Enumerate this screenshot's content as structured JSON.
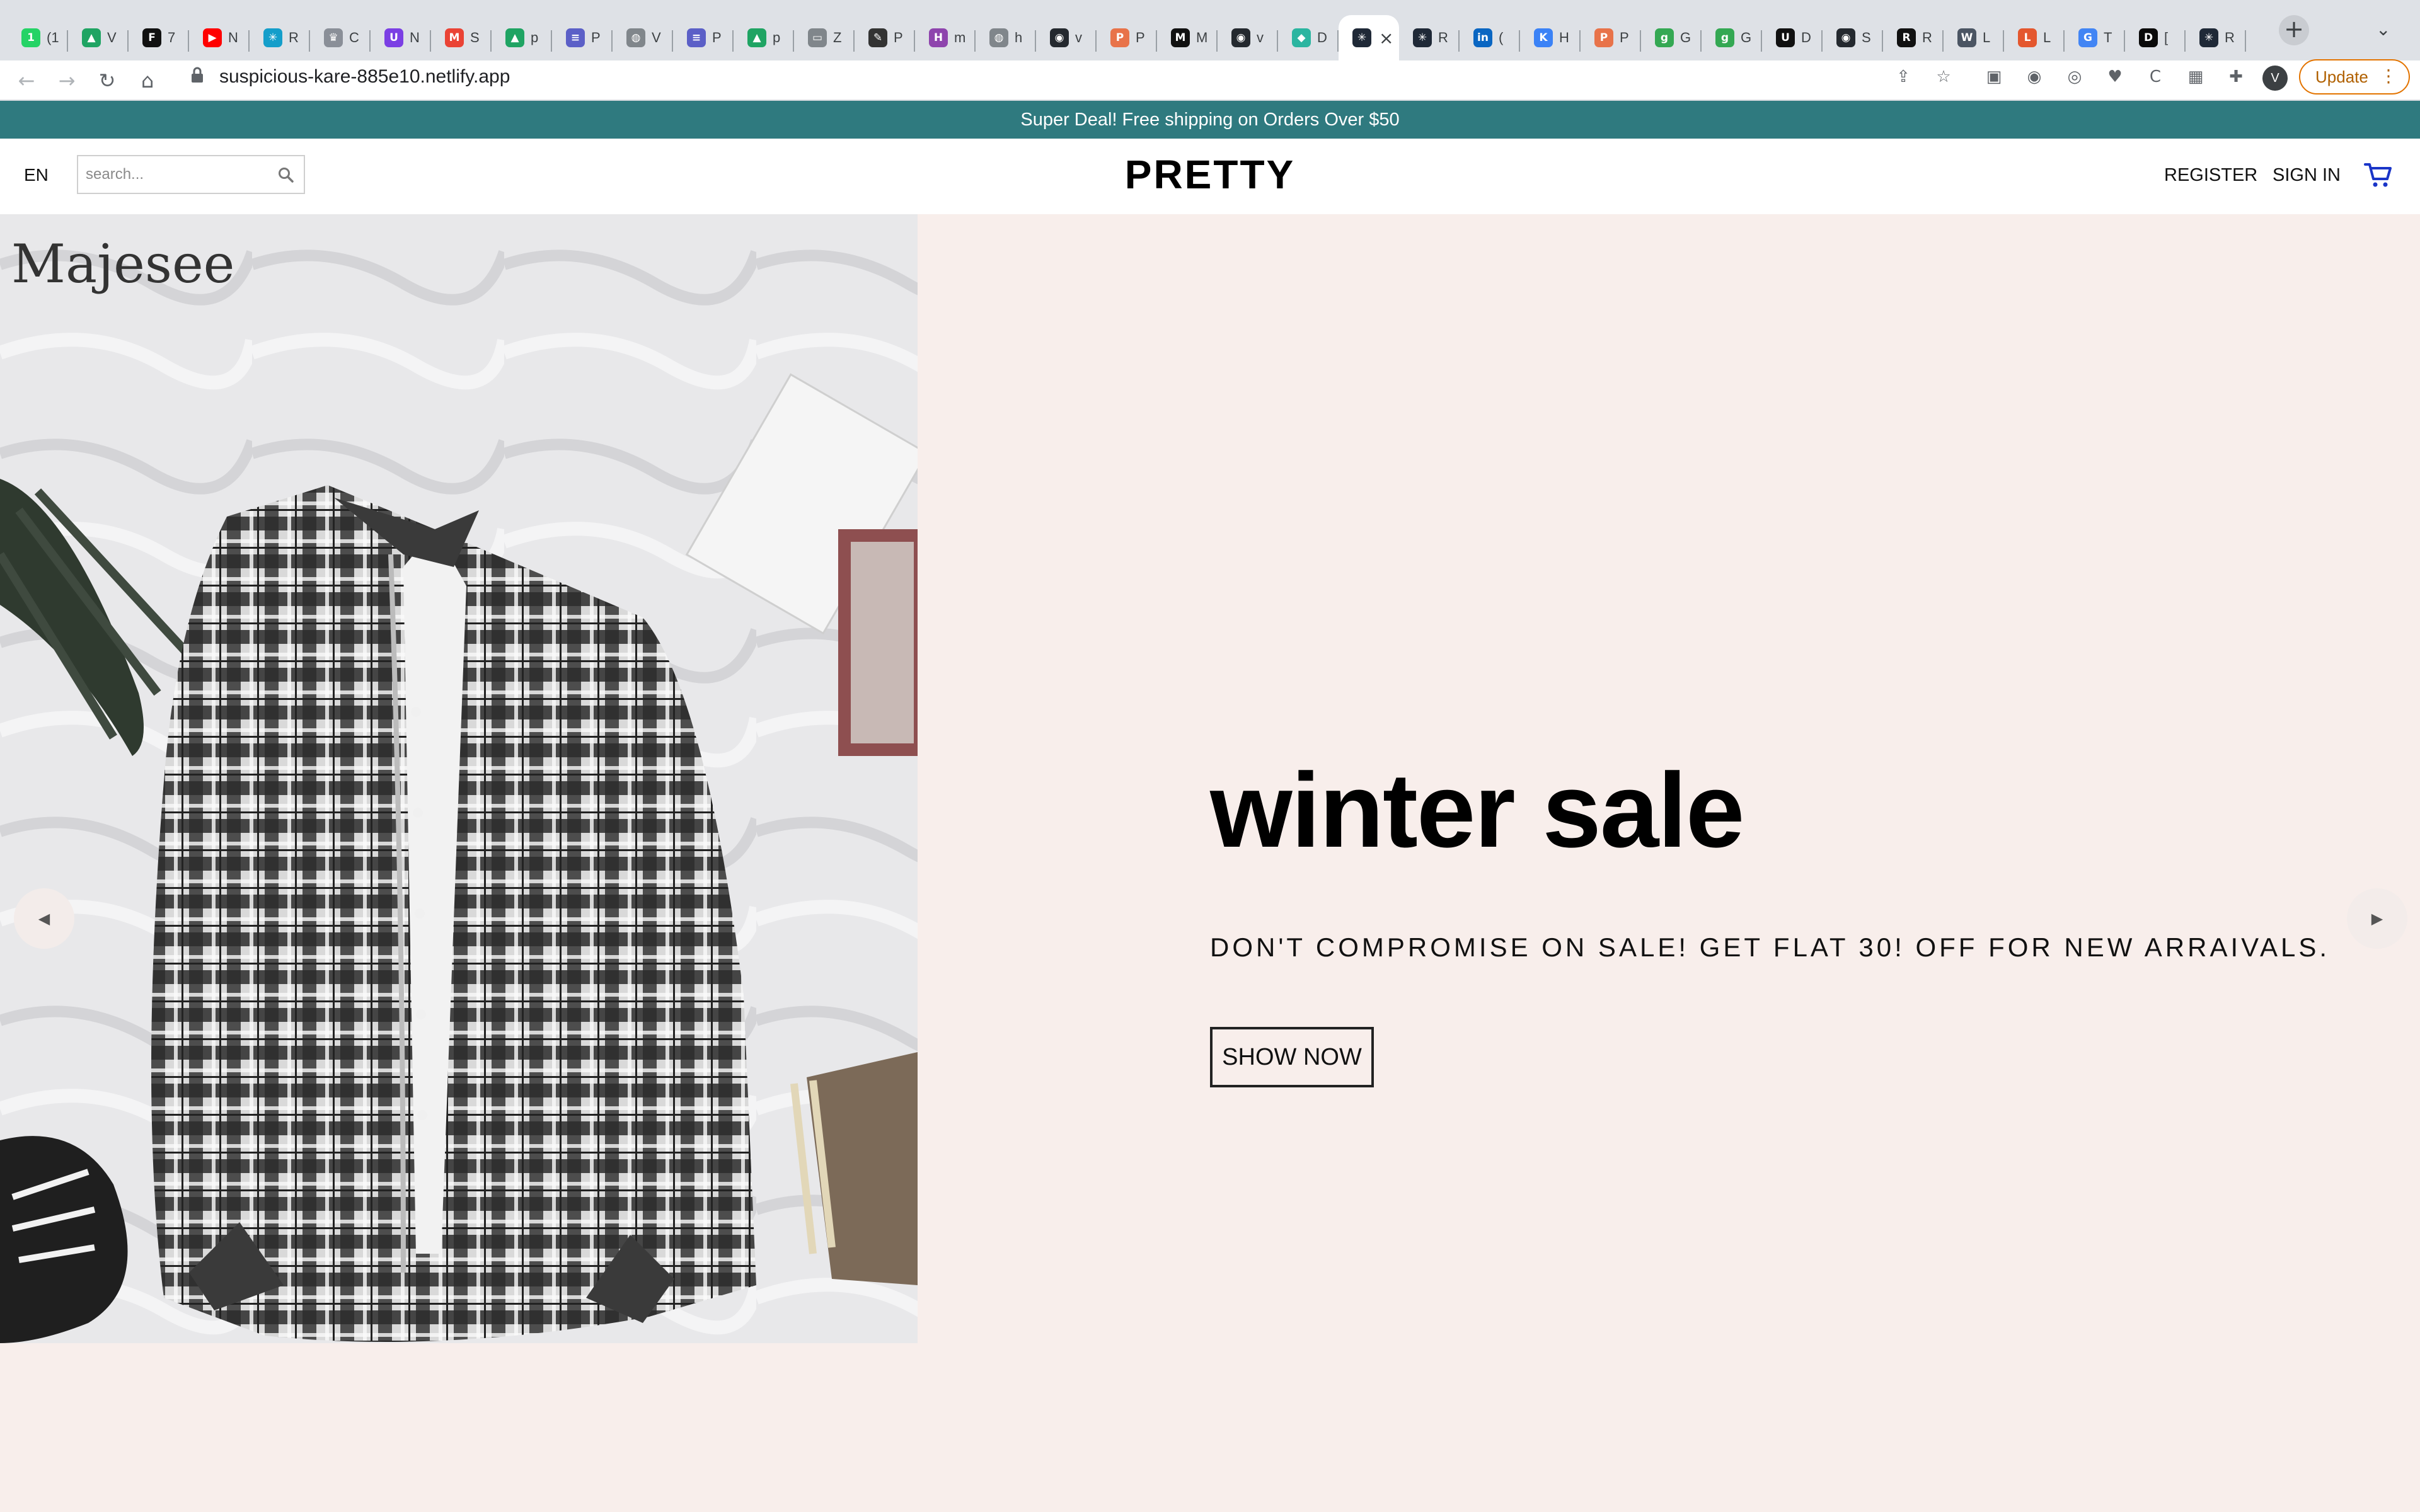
{
  "browser": {
    "tabs": [
      {
        "title": "(1",
        "icon": "whatsapp-icon",
        "color": "#25d366",
        "glyph": "1"
      },
      {
        "title": "V",
        "icon": "google-drive-icon",
        "color": "#1fa463",
        "glyph": "▲"
      },
      {
        "title": "7",
        "icon": "f-icon",
        "color": "#111111",
        "glyph": "F"
      },
      {
        "title": "N",
        "icon": "youtube-icon",
        "color": "#ff0000",
        "glyph": "▶"
      },
      {
        "title": "R",
        "icon": "react-icon",
        "color": "#149eca",
        "glyph": "✳"
      },
      {
        "title": "C",
        "icon": "crown-icon",
        "color": "#8a8f98",
        "glyph": "♛"
      },
      {
        "title": "N",
        "icon": "purple-app-icon",
        "color": "#7b3fe4",
        "glyph": "U"
      },
      {
        "title": "S",
        "icon": "gmail-icon",
        "color": "#ea4335",
        "glyph": "M"
      },
      {
        "title": "p",
        "icon": "google-drive-icon",
        "color": "#1fa463",
        "glyph": "▲"
      },
      {
        "title": "P",
        "icon": "list-icon",
        "color": "#5b5fc7",
        "glyph": "≡"
      },
      {
        "title": "V",
        "icon": "globe-icon",
        "color": "#80868b",
        "glyph": "◍"
      },
      {
        "title": "P",
        "icon": "list-icon",
        "color": "#5b5fc7",
        "glyph": "≡"
      },
      {
        "title": "p",
        "icon": "google-drive-icon",
        "color": "#1fa463",
        "glyph": "▲"
      },
      {
        "title": "Z",
        "icon": "window-icon",
        "color": "#80868b",
        "glyph": "▭"
      },
      {
        "title": "P",
        "icon": "pen-icon",
        "color": "#333333",
        "glyph": "✎"
      },
      {
        "title": "m",
        "icon": "h-icon",
        "color": "#8e44ad",
        "glyph": "H"
      },
      {
        "title": "h",
        "icon": "globe-icon",
        "color": "#80868b",
        "glyph": "◍"
      },
      {
        "title": "v",
        "icon": "github-icon",
        "color": "#24292f",
        "glyph": "◉"
      },
      {
        "title": "P",
        "icon": "p-icon",
        "color": "#e8734a",
        "glyph": "P"
      },
      {
        "title": "M",
        "icon": "m-icon",
        "color": "#111111",
        "glyph": "M"
      },
      {
        "title": "v",
        "icon": "github-icon",
        "color": "#24292f",
        "glyph": "◉"
      },
      {
        "title": "D",
        "icon": "diamond-icon",
        "color": "#2bb5a0",
        "glyph": "◆"
      },
      {
        "title": "",
        "icon": "react-icon",
        "color": "#1f2937",
        "glyph": "✳",
        "active": true
      },
      {
        "title": "R",
        "icon": "react-icon",
        "color": "#1f2937",
        "glyph": "✳"
      },
      {
        "title": "(",
        "icon": "linkedin-icon",
        "color": "#0a66c2",
        "glyph": "in"
      },
      {
        "title": "H",
        "icon": "k-icon",
        "color": "#3b82f6",
        "glyph": "K"
      },
      {
        "title": "P",
        "icon": "p-icon",
        "color": "#e8734a",
        "glyph": "P"
      },
      {
        "title": "G",
        "icon": "g-icon",
        "color": "#34a853",
        "glyph": "g"
      },
      {
        "title": "G",
        "icon": "g-icon",
        "color": "#34a853",
        "glyph": "g"
      },
      {
        "title": "D",
        "icon": "usf-icon",
        "color": "#111111",
        "glyph": "U"
      },
      {
        "title": "S",
        "icon": "github-icon",
        "color": "#24292f",
        "glyph": "◉"
      },
      {
        "title": "R",
        "icon": "r-icon",
        "color": "#111111",
        "glyph": "R"
      },
      {
        "title": "L",
        "icon": "w-icon",
        "color": "#4b5563",
        "glyph": "W"
      },
      {
        "title": "L",
        "icon": "orange-doc-icon",
        "color": "#e4572e",
        "glyph": "L"
      },
      {
        "title": "T",
        "icon": "google-icon",
        "color": "#4285f4",
        "glyph": "G"
      },
      {
        "title": "[",
        "icon": "dev-icon",
        "color": "#0a0a0a",
        "glyph": "D"
      },
      {
        "title": "R",
        "icon": "react-icon",
        "color": "#1f2937",
        "glyph": "✳"
      }
    ],
    "close_glyph": "×",
    "newtab_glyph": "+",
    "tabsearch_glyph": "⌄",
    "toolbar": {
      "back_glyph": "←",
      "forward_glyph": "→",
      "reload_glyph": "↻",
      "home_glyph": "⌂",
      "url": "suspicious-kare-885e10.netlify.app",
      "share_glyph": "⇪",
      "star_glyph": "☆",
      "extension_glyphs": [
        "▣",
        "◉",
        "◎",
        "♥",
        "C",
        "▦",
        "✚"
      ],
      "profile_initial": "V",
      "update_label": "Update",
      "menu_glyph": "⋮"
    }
  },
  "site": {
    "colors": {
      "announcement_bg": "#2f7a7f",
      "hero_bg": "#f8eeeb"
    },
    "announcement": "Super Deal! Free shipping on Orders Over $50",
    "navbar": {
      "language": "EN",
      "search_placeholder": "search...",
      "logo": "PRETTY",
      "register": "REGISTER",
      "sign_in": "SIGN IN"
    },
    "hero": {
      "photo_brand": "Majesee",
      "title": "winter sale",
      "description": "DON'T COMPROMISE ON SALE! GET FLAT 30! OFF FOR NEW ARRAIVALS.",
      "button": "SHOW NOW",
      "prev_glyph": "◀",
      "next_glyph": "▶"
    }
  }
}
